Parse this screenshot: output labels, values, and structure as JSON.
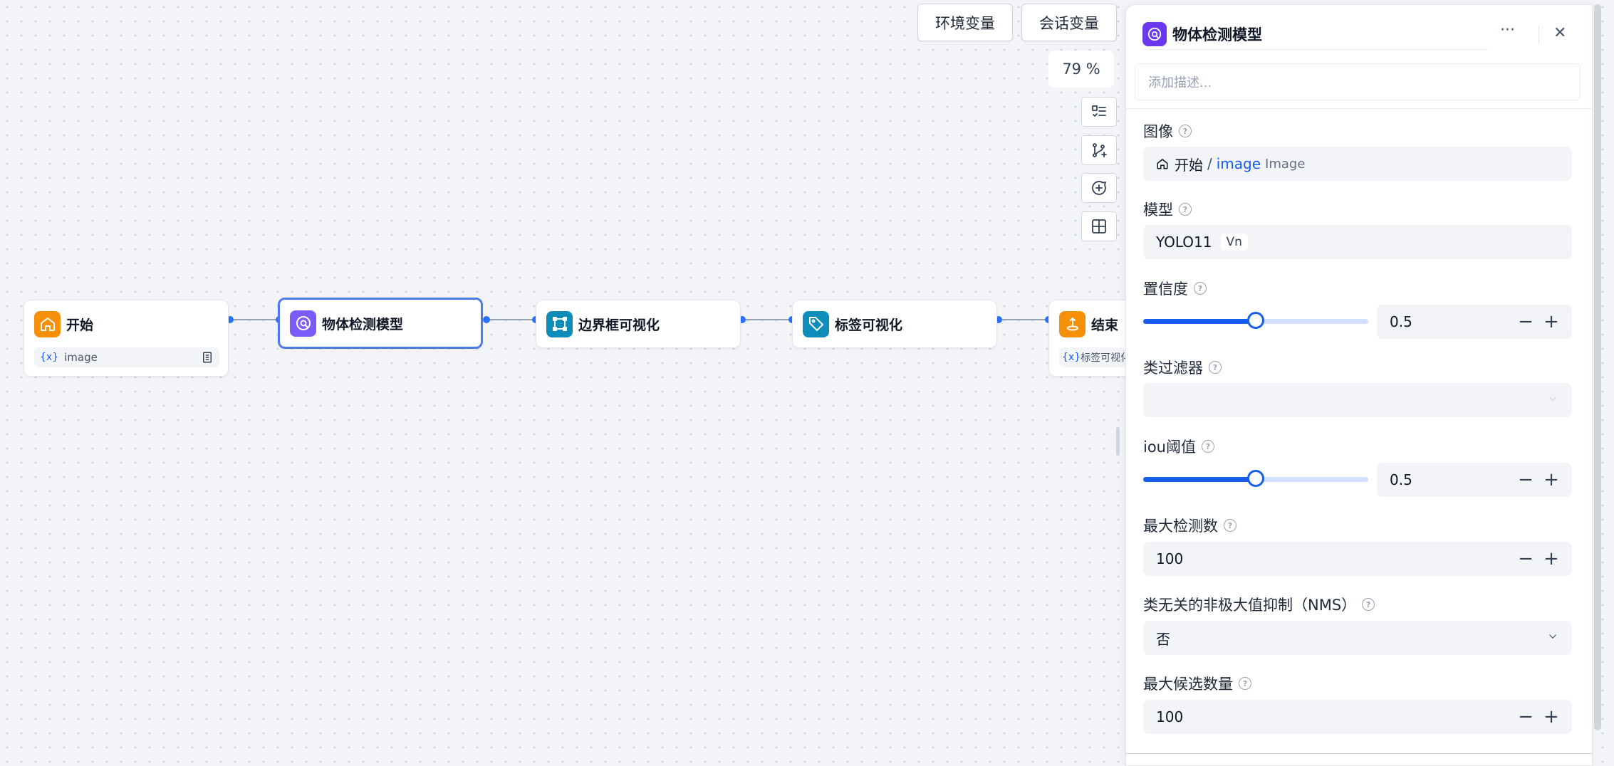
{
  "toolbar": {
    "env_vars_label": "环境变量",
    "conv_vars_label": "会话变量",
    "zoom": "79 %"
  },
  "workflow": {
    "nodes": [
      {
        "title": "开始",
        "var_icon": "{x}",
        "var": "image",
        "color": "#f79009",
        "icon": "home-icon"
      },
      {
        "title": "物体检测模型",
        "color": "#7a5af8",
        "icon": "detection-icon"
      },
      {
        "title": "边界框可视化",
        "color": "#0e8dbb",
        "icon": "bbox-icon"
      },
      {
        "title": "标签可视化",
        "color": "#0e8dbb",
        "icon": "tag-icon"
      },
      {
        "title": "结束",
        "var_icon": "{x}",
        "var": "标签可视化",
        "color": "#f79009",
        "icon": "end-icon"
      }
    ]
  },
  "panel": {
    "title": "物体检测模型",
    "description_placeholder": "添加描述...",
    "image": {
      "label": "图像",
      "source_node": "开始",
      "sep": "/",
      "var": "image",
      "type": "Image"
    },
    "model": {
      "label": "模型",
      "value": "YOLO11",
      "badge": "Vn"
    },
    "confidence": {
      "label": "置信度",
      "value": "0.5",
      "level": 0.5
    },
    "class_filter": {
      "label": "类过滤器",
      "value": ""
    },
    "iou": {
      "label": "iou阈值",
      "value": "0.5",
      "level": 0.5
    },
    "max_det": {
      "label": "最大检测数",
      "value": "100"
    },
    "agnostic_nms": {
      "label": "类无关的非极大值抑制（NMS）",
      "value": "否"
    },
    "max_candidates": {
      "label": "最大候选数量",
      "value": "100"
    },
    "help_glyph": "?",
    "minus": "−",
    "plus": "+",
    "more": "···",
    "close": "✕"
  }
}
